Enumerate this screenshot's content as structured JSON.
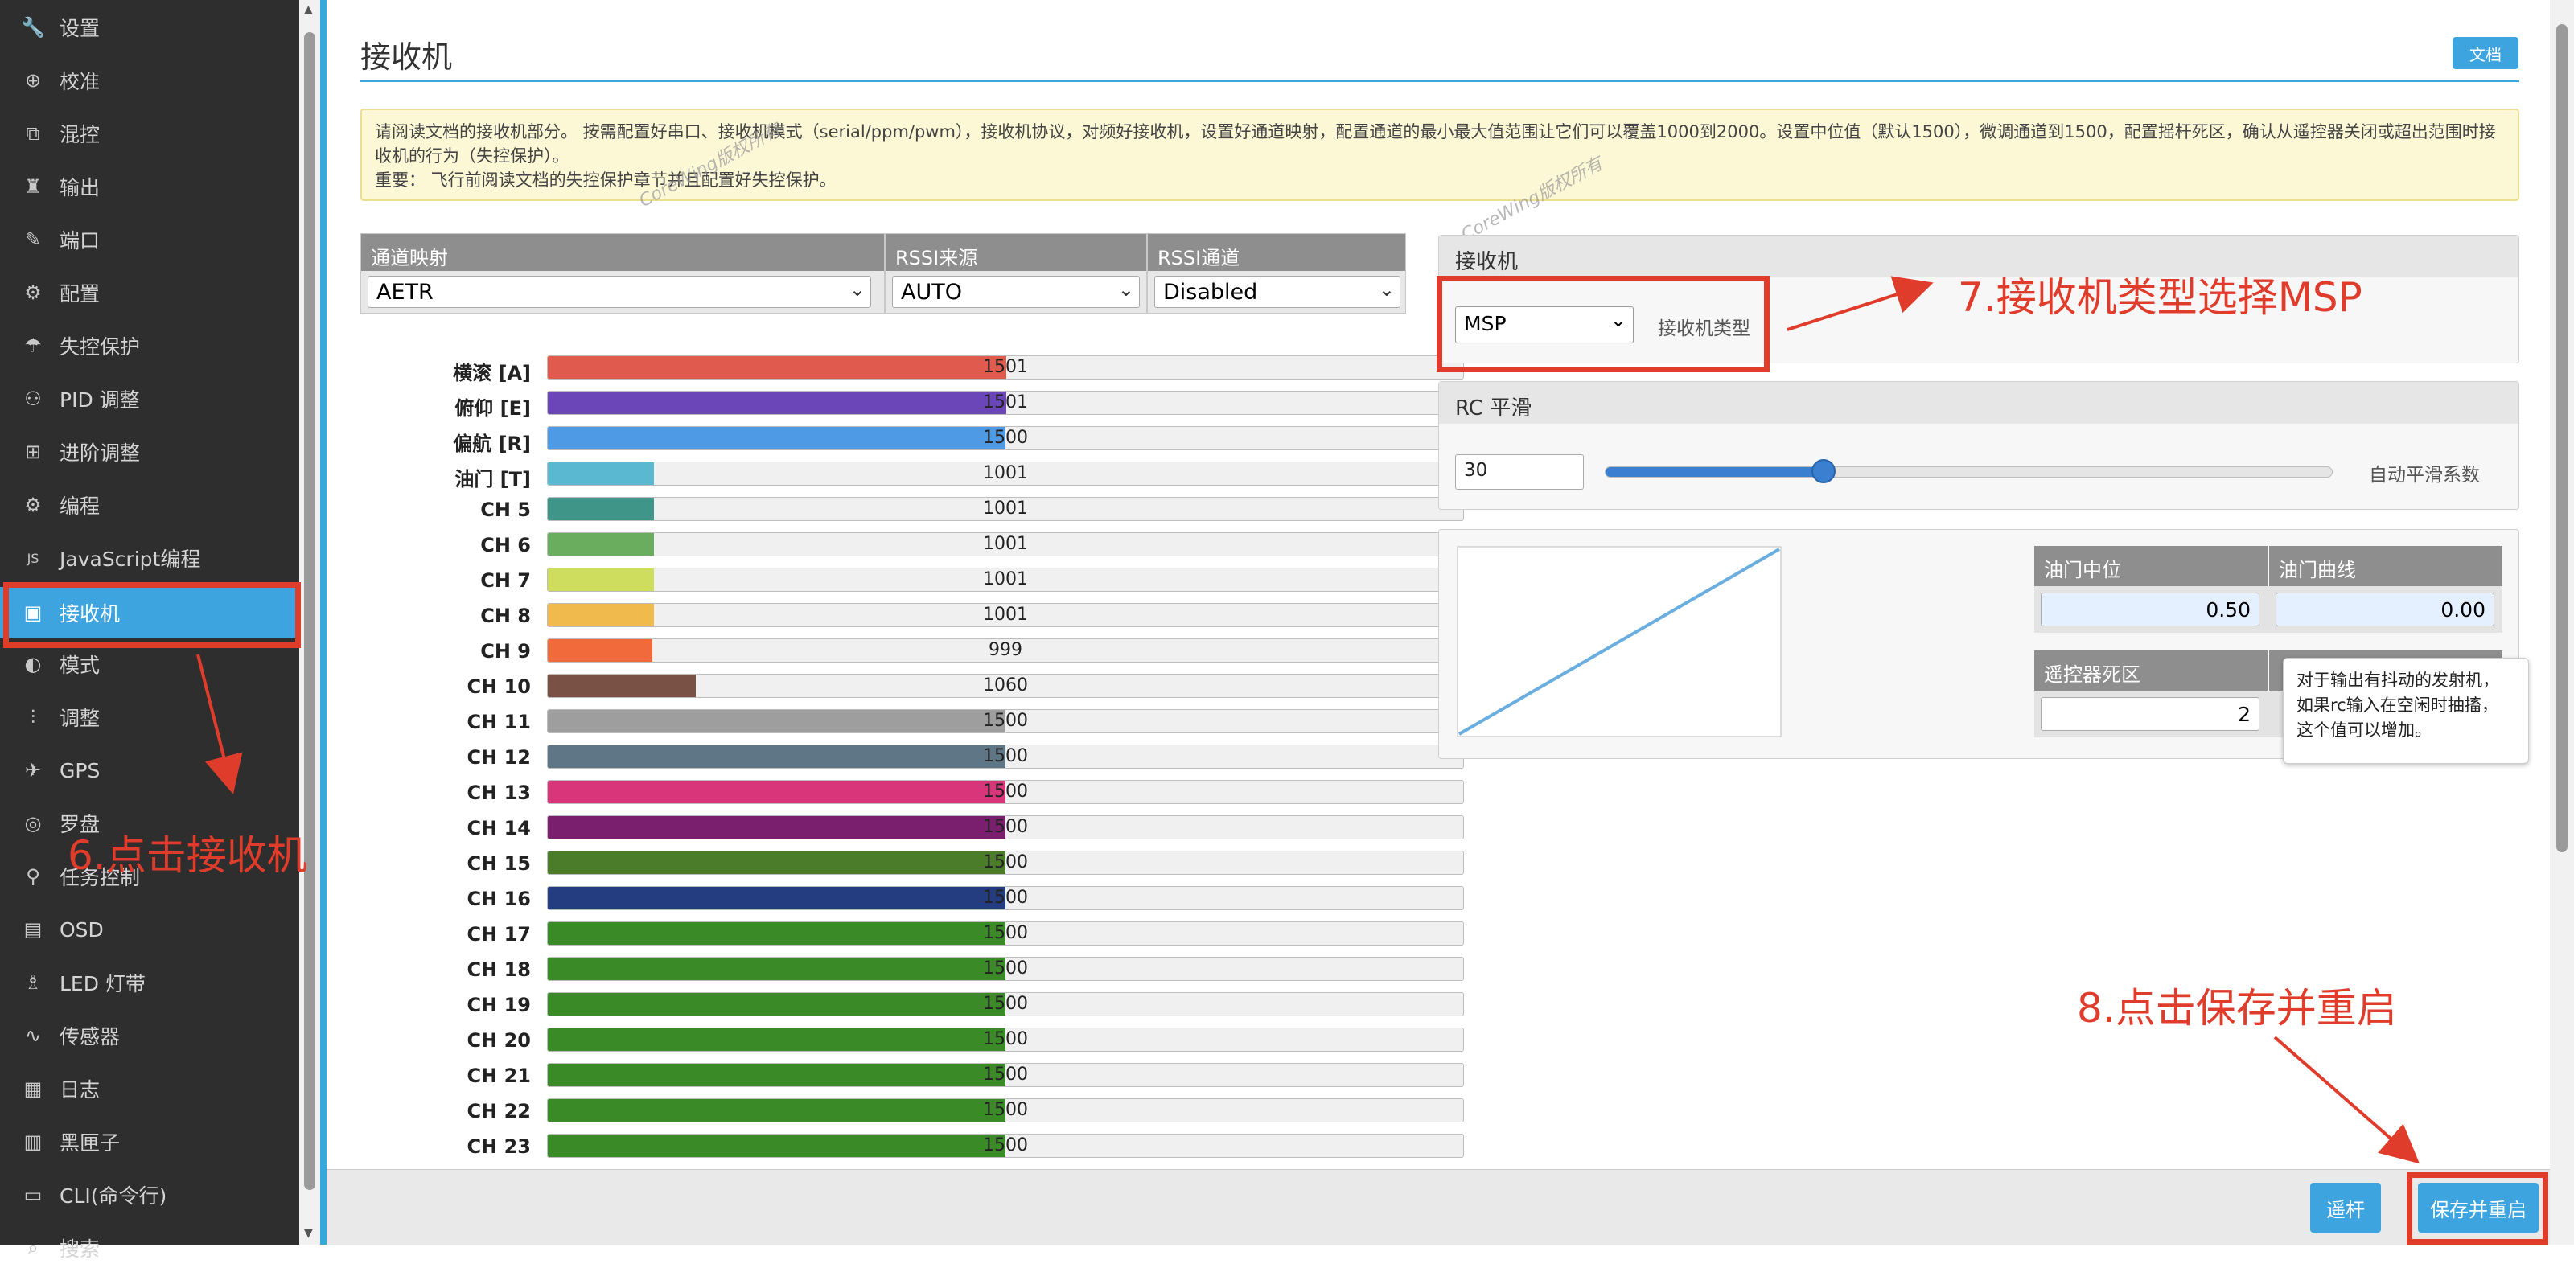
{
  "sidebar": {
    "items": [
      {
        "label": "设置",
        "icon": "wrench-icon",
        "glyph": "🔧"
      },
      {
        "label": "校准",
        "icon": "crosshair-icon",
        "glyph": "⊕"
      },
      {
        "label": "混控",
        "icon": "mixer-icon",
        "glyph": "⧉"
      },
      {
        "label": "输出",
        "icon": "motor-icon",
        "glyph": "♜"
      },
      {
        "label": "端口",
        "icon": "plug-icon",
        "glyph": "✎"
      },
      {
        "label": "配置",
        "icon": "gear-icon",
        "glyph": "⚙"
      },
      {
        "label": "失控保护",
        "icon": "failsafe-icon",
        "glyph": "☂"
      },
      {
        "label": "PID 调整",
        "icon": "network-icon",
        "glyph": "⚇"
      },
      {
        "label": "进阶调整",
        "icon": "advanced-icon",
        "glyph": "⊞"
      },
      {
        "label": "编程",
        "icon": "cog-icon",
        "glyph": "⚙"
      },
      {
        "label": "JavaScript编程",
        "icon": "js-icon",
        "glyph": "JS"
      },
      {
        "label": "接收机",
        "icon": "receiver-icon",
        "glyph": "▣"
      },
      {
        "label": "模式",
        "icon": "toggle-icon",
        "glyph": "◐"
      },
      {
        "label": "调整",
        "icon": "sliders-icon",
        "glyph": "⫶"
      },
      {
        "label": "GPS",
        "icon": "satellite-icon",
        "glyph": "✈"
      },
      {
        "label": "罗盘",
        "icon": "compass-icon",
        "glyph": "◎"
      },
      {
        "label": "任务控制",
        "icon": "map-marker-icon",
        "glyph": "⚲"
      },
      {
        "label": "OSD",
        "icon": "osd-icon",
        "glyph": "▤"
      },
      {
        "label": "LED 灯带",
        "icon": "led-icon",
        "glyph": "♗"
      },
      {
        "label": "传感器",
        "icon": "pulse-icon",
        "glyph": "∿"
      },
      {
        "label": "日志",
        "icon": "log-icon",
        "glyph": "▦"
      },
      {
        "label": "黑匣子",
        "icon": "blackbox-icon",
        "glyph": "▥"
      },
      {
        "label": "CLI(命令行)",
        "icon": "terminal-icon",
        "glyph": "▭"
      },
      {
        "label": "搜索",
        "icon": "search-icon",
        "glyph": "⌕"
      }
    ],
    "active_index": 11
  },
  "header": {
    "title": "接收机",
    "doc_button": "文档"
  },
  "note": {
    "line1": "请阅读文档的接收机部分。 按需配置好串口、接收机模式（serial/ppm/pwm），接收机协议，对频好接收机，设置好通道映射，配置通道的最小最大值范围让它们可以覆盖1000到2000。设置中位值（默认1500），微调通道到1500，配置摇杆死区，确认从遥控器关闭或超出范围时接收机的行为（失控保护）。",
    "line2": "重要：  飞行前阅读文档的失控保护章节并且配置好失控保护。"
  },
  "watermark": "CoreWing版权所有",
  "channel_map": {
    "label": "通道映射",
    "value": "AETR"
  },
  "rssi_source": {
    "label": "RSSI来源",
    "value": "AUTO"
  },
  "rssi_channel": {
    "label": "RSSI通道",
    "value": "Disabled"
  },
  "channels": [
    {
      "label": "横滚 [A]",
      "value": 1501,
      "color": "#e05a4e"
    },
    {
      "label": "俯仰 [E]",
      "value": 1501,
      "color": "#6a46b8"
    },
    {
      "label": "偏航 [R]",
      "value": 1500,
      "color": "#4e9ae5"
    },
    {
      "label": "油门 [T]",
      "value": 1001,
      "color": "#5ab8d0"
    },
    {
      "label": "CH 5",
      "value": 1001,
      "color": "#3f9688"
    },
    {
      "label": "CH 6",
      "value": 1001,
      "color": "#6aad5e"
    },
    {
      "label": "CH 7",
      "value": 1001,
      "color": "#cfdd5f"
    },
    {
      "label": "CH 8",
      "value": 1001,
      "color": "#f1ba4c"
    },
    {
      "label": "CH 9",
      "value": 999,
      "color": "#f06a3c"
    },
    {
      "label": "CH 10",
      "value": 1060,
      "color": "#7a5245"
    },
    {
      "label": "CH 11",
      "value": 1500,
      "color": "#9e9e9e"
    },
    {
      "label": "CH 12",
      "value": 1500,
      "color": "#5f7687"
    },
    {
      "label": "CH 13",
      "value": 1500,
      "color": "#d8357a"
    },
    {
      "label": "CH 14",
      "value": 1500,
      "color": "#7a1f6e"
    },
    {
      "label": "CH 15",
      "value": 1500,
      "color": "#4a7c2a"
    },
    {
      "label": "CH 16",
      "value": 1500,
      "color": "#243c80"
    },
    {
      "label": "CH 17",
      "value": 1500,
      "color": "#3a8a28"
    },
    {
      "label": "CH 18",
      "value": 1500,
      "color": "#3a8a28"
    },
    {
      "label": "CH 19",
      "value": 1500,
      "color": "#3a8a28"
    },
    {
      "label": "CH 20",
      "value": 1500,
      "color": "#3a8a28"
    },
    {
      "label": "CH 21",
      "value": 1500,
      "color": "#3a8a28"
    },
    {
      "label": "CH 22",
      "value": 1500,
      "color": "#3a8a28"
    },
    {
      "label": "CH 23",
      "value": 1500,
      "color": "#3a8a28"
    }
  ],
  "receiver": {
    "title": "接收机",
    "type_value": "MSP",
    "type_label": "接收机类型"
  },
  "rc_smoothing": {
    "title": "RC 平滑",
    "value": "30",
    "label": "自动平滑系数",
    "slider_fraction": 0.3
  },
  "throttle": {
    "mid_label": "油门中位",
    "mid_value": "0.50",
    "expo_label": "油门曲线",
    "expo_value": "0.00",
    "deadband_label": "遥控器死区",
    "deadband_value": "2"
  },
  "tooltip": {
    "line1": "对于输出有抖动的发射机，",
    "line2": "如果rc输入在空闲时抽搐，",
    "line3": "这个值可以增加。"
  },
  "bottom": {
    "sticks_button": "遥杆",
    "save_button": "保存并重启"
  },
  "annotations": {
    "step6": "6.点击接收机",
    "step7": "7.接收机类型选择MSP",
    "step8": "8.点击保存并重启"
  },
  "colors": {
    "accent": "#3da4e0",
    "annotation": "#e03c2b",
    "sidebar_bg": "#2e2e2e"
  }
}
